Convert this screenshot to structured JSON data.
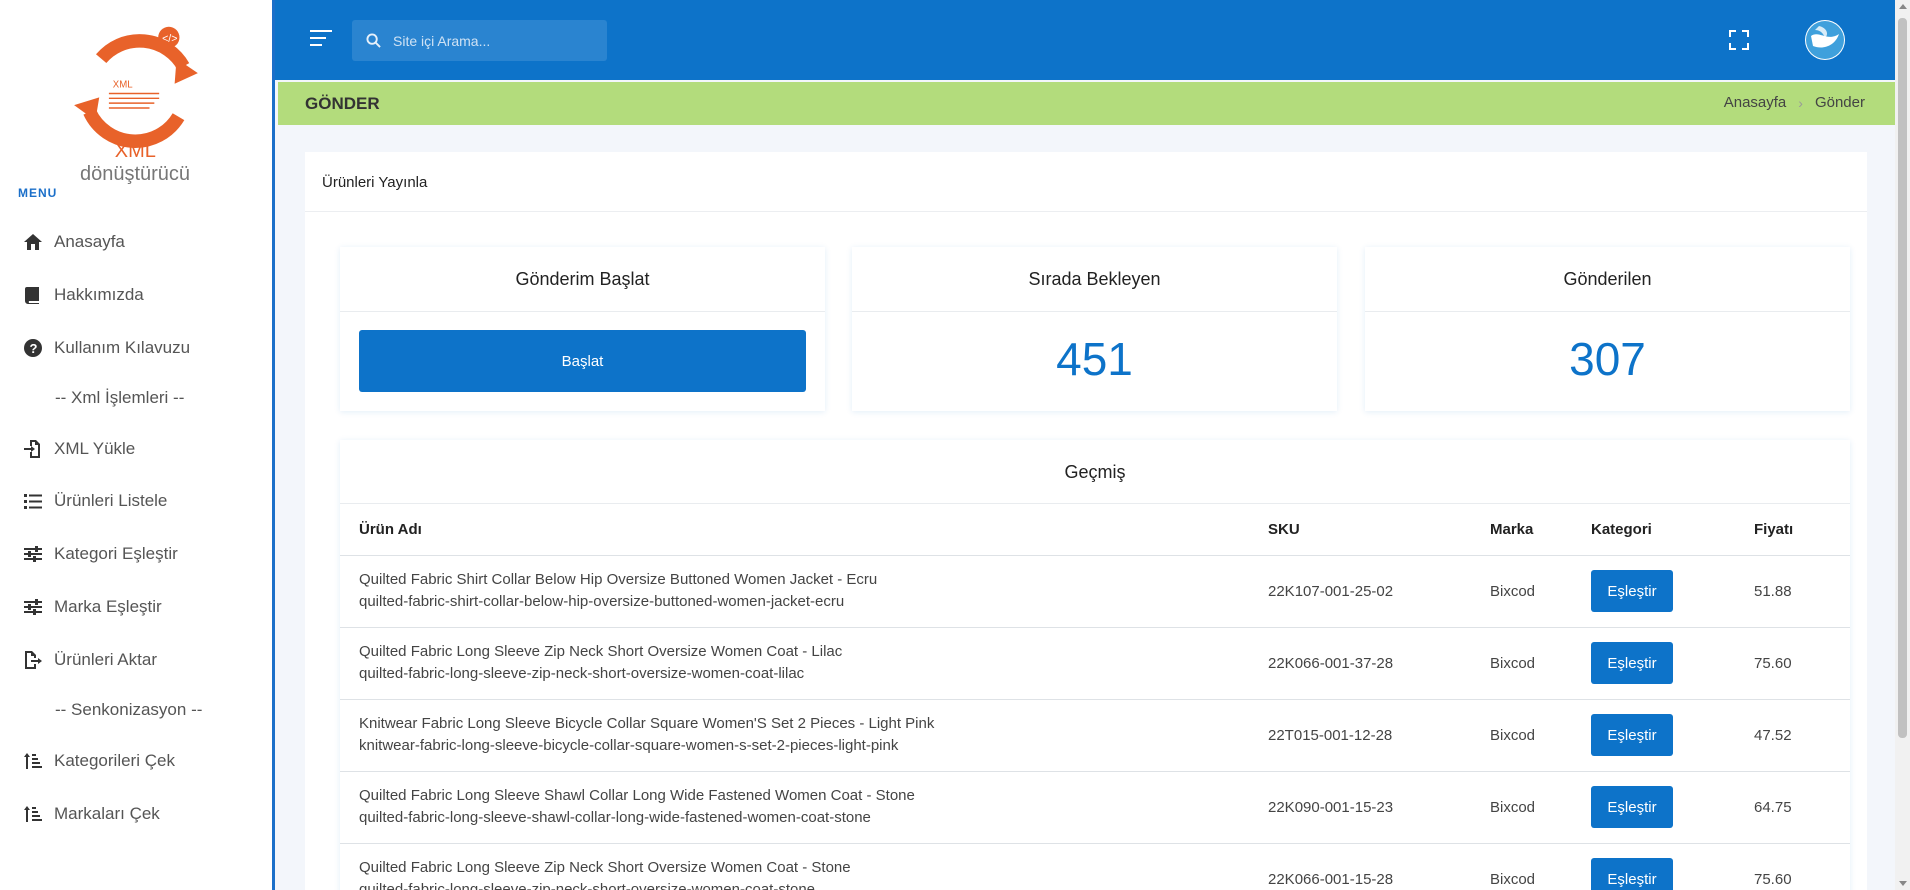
{
  "logo": {
    "text_colored": "XML",
    "text_rest": " dönüştürücü",
    "inner_text": "XML"
  },
  "sidebar": {
    "menu_title": "MENU",
    "items": [
      {
        "label": "Anasayfa",
        "icon": "home-icon"
      },
      {
        "label": "Hakkımızda",
        "icon": "book-icon"
      },
      {
        "label": "Kullanım Kılavuzu",
        "icon": "question-circle-icon"
      },
      {
        "label": "XML Yükle",
        "icon": "file-import-icon"
      },
      {
        "label": "Ürünleri Listele",
        "icon": "list-icon"
      },
      {
        "label": "Kategori Eşleştir",
        "icon": "sliders-icon"
      },
      {
        "label": "Marka Eşleştir",
        "icon": "sliders-icon"
      },
      {
        "label": "Ürünleri Aktar",
        "icon": "file-export-icon"
      },
      {
        "label": "Kategorileri Çek",
        "icon": "sort-amount-icon"
      },
      {
        "label": "Markaları Çek",
        "icon": "sort-amount-icon"
      }
    ],
    "separators": [
      "-- Xml İşlemleri --",
      "-- Senkonizasyon --"
    ]
  },
  "topbar": {
    "search_placeholder": "Site içi Arama..."
  },
  "titlebar": {
    "title": "GÖNDER",
    "breadcrumb": [
      "Anasayfa",
      "Gönder"
    ]
  },
  "main": {
    "card_title": "Ürünleri Yayınla",
    "stats": {
      "start": {
        "title": "Gönderim Başlat",
        "button": "Başlat"
      },
      "queued": {
        "title": "Sırada Bekleyen",
        "value": "451"
      },
      "sent": {
        "title": "Gönderilen",
        "value": "307"
      }
    },
    "history": {
      "title": "Geçmiş",
      "columns": [
        "Ürün Adı",
        "SKU",
        "Marka",
        "Kategori",
        "Fiyatı"
      ],
      "match_label": "Eşleştir",
      "rows": [
        {
          "name": "Quilted Fabric Shirt Collar Below Hip Oversize Buttoned Women Jacket - Ecru",
          "slug": "quilted-fabric-shirt-collar-below-hip-oversize-buttoned-women-jacket-ecru",
          "sku": "22K107-001-25-02",
          "brand": "Bixcod",
          "price": "51.88"
        },
        {
          "name": "Quilted Fabric Long Sleeve Zip Neck Short Oversize Women Coat - Lilac",
          "slug": "quilted-fabric-long-sleeve-zip-neck-short-oversize-women-coat-lilac",
          "sku": "22K066-001-37-28",
          "brand": "Bixcod",
          "price": "75.60"
        },
        {
          "name": "Knitwear Fabric Long Sleeve Bicycle Collar Square Women'S Set 2 Pieces - Light Pink",
          "slug": "knitwear-fabric-long-sleeve-bicycle-collar-square-women-s-set-2-pieces-light-pink",
          "sku": "22T015-001-12-28",
          "brand": "Bixcod",
          "price": "47.52"
        },
        {
          "name": "Quilted Fabric Long Sleeve Shawl Collar Long Wide Fastened Women Coat - Stone",
          "slug": "quilted-fabric-long-sleeve-shawl-collar-long-wide-fastened-women-coat-stone",
          "sku": "22K090-001-15-23",
          "brand": "Bixcod",
          "price": "64.75"
        },
        {
          "name": "Quilted Fabric Long Sleeve Zip Neck Short Oversize Women Coat - Stone",
          "slug": "quilted-fabric-long-sleeve-zip-neck-short-oversize-women-coat-stone",
          "sku": "22K066-001-15-28",
          "brand": "Bixcod",
          "price": "75.60"
        }
      ]
    }
  },
  "colors": {
    "primary": "#0d73c9",
    "titlebar": "#b3dc7c",
    "logo_orange": "#e8622a"
  }
}
